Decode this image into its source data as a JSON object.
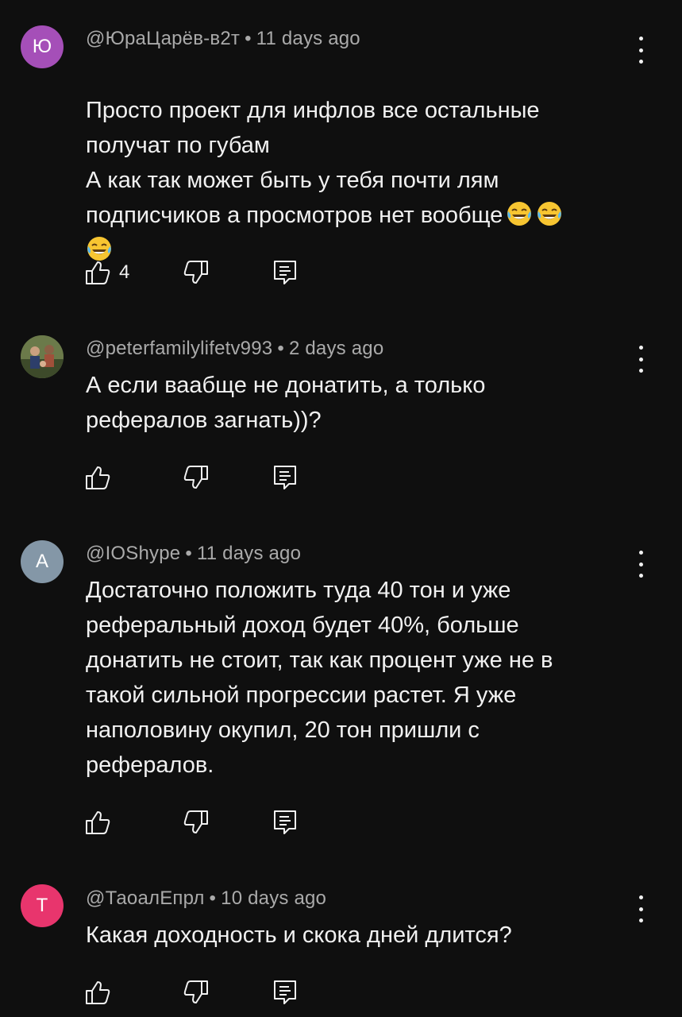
{
  "comments": [
    {
      "avatar_letter": "Ю",
      "avatar_color": "#a54fb8",
      "author": "@ЮраЦарёв-в2т",
      "time": "11 days ago",
      "text_lines": "Просто проект для инфлов все остальные\nполучат по губам\nА как так может быть у тебя почти лям\nподписчиков а просмотров нет вообще",
      "emoji_icons": [
        "tears-of-joy-emoji",
        "tears-of-joy-emoji",
        "tears-of-joy-emoji"
      ],
      "likes": "4"
    },
    {
      "avatar_letter": "",
      "avatar_color": "#4a5a3a",
      "author": "@peterfamilylifetv993",
      "time": "2 days ago",
      "text_lines": "А если ваабще не донатить, а только\nрефералов загнать))?",
      "likes": ""
    },
    {
      "avatar_letter": "A",
      "avatar_color": "#8497a7",
      "author": "@IOShype",
      "time": "11 days ago",
      "text_lines": "Достаточно положить туда 40 тон и уже\nреферальный доход будет 40%, больше\nдонатить не стоит, так как процент уже не в\nтакой сильной прогрессии растет. Я уже\nнаполовину окупил, 20 тон пришли с\nрефералов.",
      "likes": ""
    },
    {
      "avatar_letter": "T",
      "avatar_color": "#e8356d",
      "author": "@ТаоалЕпрл",
      "time": "10 days ago",
      "text_lines": "Какая доходность и скока дней длится?",
      "likes": ""
    }
  ],
  "icons": {
    "like": "thumbs-up-icon",
    "dislike": "thumbs-down-icon",
    "reply": "reply-comment-icon",
    "more": "more-vertical-icon"
  }
}
